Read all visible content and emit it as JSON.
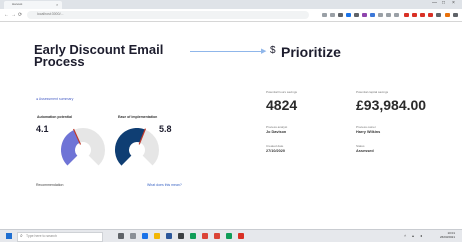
{
  "browser": {
    "tab_title": "Harvest",
    "tab_close": "×",
    "window_controls": [
      "—",
      "□",
      "×"
    ],
    "address": "localhost:3000/...",
    "nav": [
      "←",
      "→",
      "⟳"
    ]
  },
  "page": {
    "title": "Early Discount Email Process",
    "prioritize_title": "Prioritize",
    "prioritize_icon": "$",
    "assessment_link": "Assessment summary",
    "automation_label": "Automation potential",
    "automation_value": "4.1",
    "ease_label": "Ease of implementation",
    "ease_value": "5.8",
    "recommendation_label": "Recommendation",
    "what_link": "What does this mean?"
  },
  "gauges": {
    "automation_fraction": 0.41,
    "ease_fraction": 0.58,
    "automation_color": "#6f74d6",
    "ease_color": "#0f3e73"
  },
  "metrics": {
    "hours_label": "Potential hours savings",
    "hours_value": "4824",
    "capital_label": "Potential capital savings",
    "capital_value": "£93,984.00",
    "owner_label": "Process analyst",
    "owner_value": "Jo Davison",
    "process_owner_label": "Process owner",
    "process_owner_value": "Harry Wilkins",
    "created_label": "Created date",
    "created_value": "27/10/2020",
    "status_label": "Status",
    "status_value": "Assessed"
  },
  "taskbar": {
    "search_placeholder": "Type here to search",
    "time": "10:01",
    "date": "26/03/2021"
  }
}
